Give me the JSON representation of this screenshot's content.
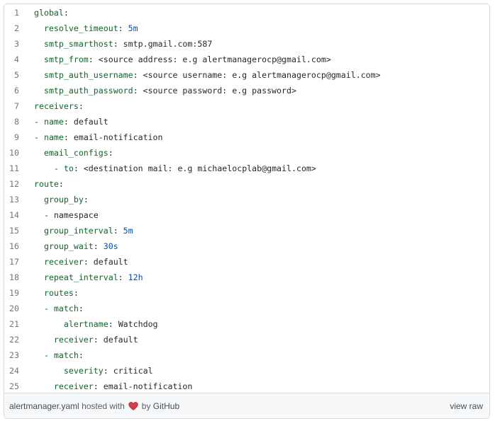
{
  "code_lines": [
    {
      "num": "1",
      "indent": "",
      "dash": "",
      "key": "global",
      "value": ""
    },
    {
      "num": "2",
      "indent": "  ",
      "dash": "",
      "key": "resolve_timeout",
      "value": "5m",
      "vclass": "val-blue"
    },
    {
      "num": "3",
      "indent": "  ",
      "dash": "",
      "key": "smtp_smarthost",
      "value": "smtp.gmail.com:587"
    },
    {
      "num": "4",
      "indent": "  ",
      "dash": "",
      "key": "smtp_from",
      "value": "<source address: e.g alertmanagerocp@gmail.com>"
    },
    {
      "num": "5",
      "indent": "  ",
      "dash": "",
      "key": "smtp_auth_username",
      "value": "<source username: e.g alertmanagerocp@gmail.com>"
    },
    {
      "num": "6",
      "indent": "  ",
      "dash": "",
      "key": "smtp_auth_password",
      "value": "<source password: e.g password>"
    },
    {
      "num": "7",
      "indent": "",
      "dash": "",
      "key": "receivers",
      "value": ""
    },
    {
      "num": "8",
      "indent": "",
      "dash": "- ",
      "key": "name",
      "value": "default"
    },
    {
      "num": "9",
      "indent": "",
      "dash": "- ",
      "key": "name",
      "value": "email-notification"
    },
    {
      "num": "10",
      "indent": "  ",
      "dash": "",
      "key": "email_configs",
      "value": ""
    },
    {
      "num": "11",
      "indent": "    ",
      "dash": "- ",
      "key": "to",
      "value": "<destination mail: e.g michaelocplab@gmail.com>"
    },
    {
      "num": "12",
      "indent": "",
      "dash": "",
      "key": "route",
      "value": ""
    },
    {
      "num": "13",
      "indent": "  ",
      "dash": "",
      "key": "group_by",
      "value": ""
    },
    {
      "num": "14",
      "indent": "  ",
      "dash": "- ",
      "key": "",
      "value": "namespace",
      "plain": true
    },
    {
      "num": "15",
      "indent": "  ",
      "dash": "",
      "key": "group_interval",
      "value": "5m",
      "vclass": "val-blue"
    },
    {
      "num": "16",
      "indent": "  ",
      "dash": "",
      "key": "group_wait",
      "value": "30s",
      "vclass": "val-blue"
    },
    {
      "num": "17",
      "indent": "  ",
      "dash": "",
      "key": "receiver",
      "value": "default"
    },
    {
      "num": "18",
      "indent": "  ",
      "dash": "",
      "key": "repeat_interval",
      "value": "12h",
      "vclass": "val-blue"
    },
    {
      "num": "19",
      "indent": "  ",
      "dash": "",
      "key": "routes",
      "value": ""
    },
    {
      "num": "20",
      "indent": "  ",
      "dash": "- ",
      "key": "match",
      "value": ""
    },
    {
      "num": "21",
      "indent": "      ",
      "dash": "",
      "key": "alertname",
      "value": "Watchdog"
    },
    {
      "num": "22",
      "indent": "    ",
      "dash": "",
      "key": "receiver",
      "value": "default"
    },
    {
      "num": "23",
      "indent": "  ",
      "dash": "- ",
      "key": "match",
      "value": ""
    },
    {
      "num": "24",
      "indent": "      ",
      "dash": "",
      "key": "severity",
      "value": "critical"
    },
    {
      "num": "25",
      "indent": "    ",
      "dash": "",
      "key": "receiver",
      "value": "email-notification"
    }
  ],
  "footer": {
    "file_name": "alertmanager.yaml",
    "hosted_with": "hosted with",
    "by": "by",
    "github": "GitHub",
    "view_raw": "view raw"
  },
  "colors": {
    "key": "#116329",
    "number": "#0550ae",
    "heart": "#d73a49"
  }
}
